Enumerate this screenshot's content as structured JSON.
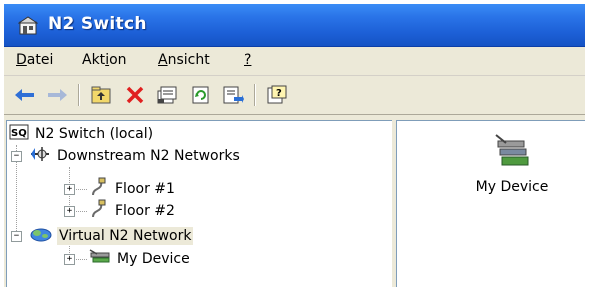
{
  "window": {
    "title": "N2 Switch"
  },
  "menu": {
    "items": [
      {
        "pre": "",
        "ul": "D",
        "post": "atei"
      },
      {
        "pre": "Akt",
        "ul": "i",
        "post": "on"
      },
      {
        "pre": "",
        "ul": "A",
        "post": "nsicht"
      },
      {
        "pre": "",
        "ul": "?",
        "post": ""
      }
    ]
  },
  "toolbar": {
    "icons": [
      "back-arrow-icon",
      "forward-arrow-icon",
      "up-folder-icon",
      "delete-icon",
      "properties-icon",
      "refresh-icon",
      "export-icon",
      "help-icon"
    ]
  },
  "tree": {
    "root": "N2 Switch (local)",
    "downstream": "Downstream N2 Networks",
    "floor1": "Floor #1",
    "floor2": "Floor #2",
    "virtual": "Virtual N2 Network",
    "my_device": "My Device"
  },
  "content": {
    "device_label": "My Device"
  },
  "colors": {
    "title_blue": "#2a74e8",
    "chrome": "#ece9d8",
    "delete_red": "#e02020"
  }
}
